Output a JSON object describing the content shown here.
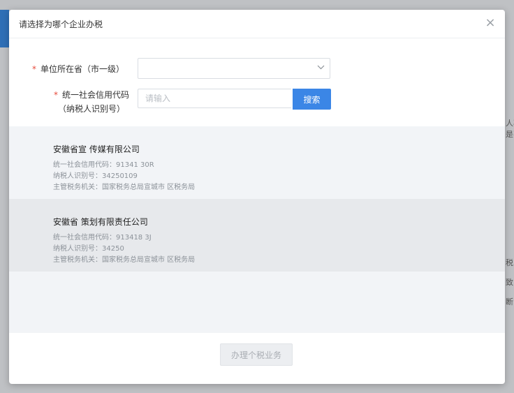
{
  "dialog": {
    "title": "请选择为哪个企业办税",
    "close_symbol": "×"
  },
  "form": {
    "required_mark": "*",
    "province_label": "单位所在省（市一级）",
    "province_value": "",
    "credit_code_label_line1": "统一社会信用代码",
    "credit_code_label_line2": "（纳税人识别号）",
    "credit_code_placeholder": "请输入",
    "search_button": "搜索"
  },
  "results": [
    {
      "name": "安徽省宣 传媒有限公司",
      "credit_code": "统一社会信用代码：91341 30R",
      "taxpayer_id": "纳税人识别号：34250109",
      "tax_authority": "主管税务机关：国家税务总局宣城市 区税务局"
    },
    {
      "name": "安徽省 策划有限责任公司",
      "credit_code": "统一社会信用代码：913418 3J",
      "taxpayer_id": "纳税人识别号：34250",
      "tax_authority": "主管税务机关：国家税务总局宣城市 区税务局"
    }
  ],
  "footer": {
    "submit_button": "办理个税业务"
  },
  "background": {
    "right_fragments": [
      "人石",
      "是不",
      "税",
      "致",
      "断"
    ]
  }
}
